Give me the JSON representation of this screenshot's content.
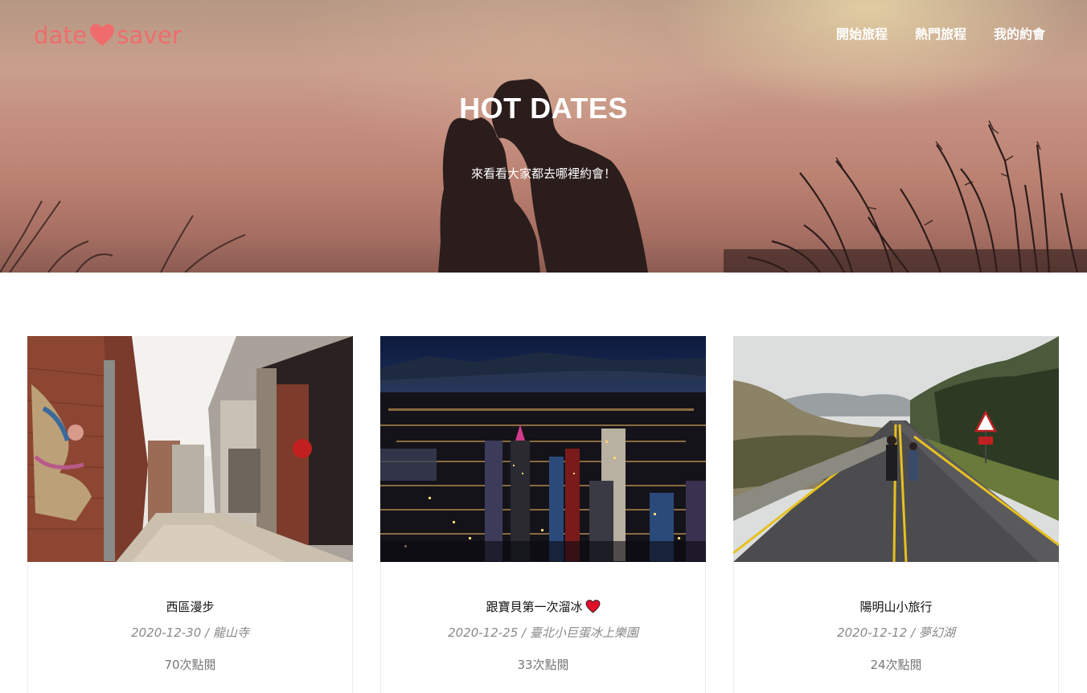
{
  "header": {
    "logo": {
      "left": "date",
      "right": "saver",
      "icon": "heart-icon",
      "color": "#f06c6c"
    },
    "nav": [
      {
        "label": "開始旅程"
      },
      {
        "label": "熱門旅程"
      },
      {
        "label": "我的約會"
      }
    ]
  },
  "hero": {
    "title": "HOT DATES",
    "subtitle": "來看看大家都去哪裡約會！"
  },
  "cards": [
    {
      "title": "西區漫步",
      "date": "2020-12-30",
      "location": "龍山寺",
      "views": "70次點閱",
      "title_icon": ""
    },
    {
      "title": "跟寶貝第一次溜冰",
      "date": "2020-12-25",
      "location": "臺北小巨蛋冰上樂園",
      "views": "33次點閱",
      "title_icon": "red-heart-icon"
    },
    {
      "title": "陽明山小旅行",
      "date": "2020-12-12",
      "location": "夢幻湖",
      "views": "24次點閱",
      "title_icon": ""
    }
  ],
  "colors": {
    "accent": "#f06c6c",
    "text_muted": "#8a8a8a"
  }
}
